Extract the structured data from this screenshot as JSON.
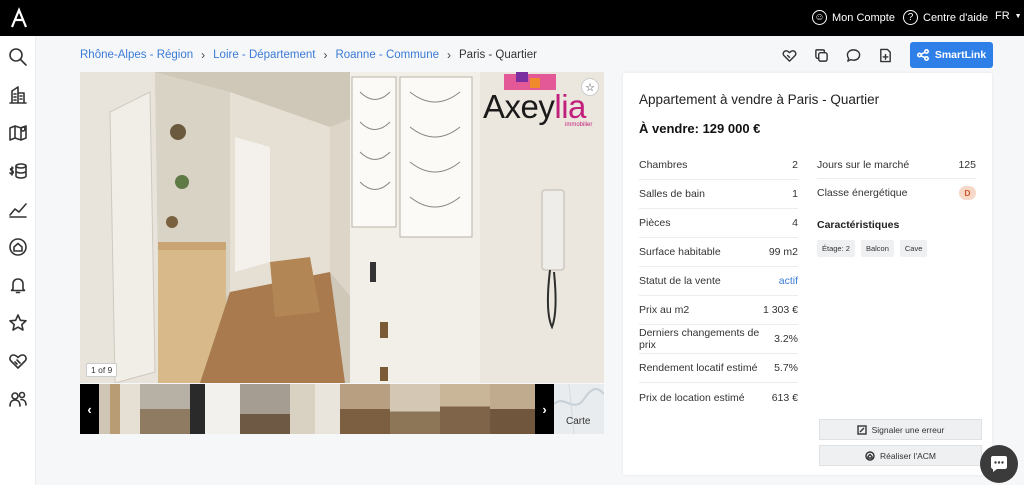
{
  "topbar": {
    "account_label": "Mon Compte",
    "help_label": "Centre d'aide",
    "lang": "FR"
  },
  "sidebar": {
    "items": [
      "search-icon",
      "building-icon",
      "map-icon",
      "finance-icon",
      "chart-icon",
      "home-alert-icon",
      "bell-icon",
      "star-icon",
      "handshake-icon",
      "users-icon"
    ]
  },
  "breadcrumb": [
    {
      "label": "Rhône-Alpes - Région"
    },
    {
      "label": "Loire - Département"
    },
    {
      "label": "Roanne - Commune"
    },
    {
      "label": "Paris - Quartier"
    }
  ],
  "toolbar": {
    "smartlink_label": "SmartLink"
  },
  "gallery": {
    "counter": "1 of 9",
    "brand_main": "Axey",
    "brand_accent": "lia",
    "brand_sub": "immobilier",
    "map_label": "Carte"
  },
  "listing": {
    "title": "Appartement à vendre à Paris - Quartier",
    "price": "À vendre: 129 000 €",
    "left_rows": [
      {
        "label": "Chambres",
        "value": "2"
      },
      {
        "label": "Salles de bain",
        "value": "1"
      },
      {
        "label": "Pièces",
        "value": "4"
      },
      {
        "label": "Surface habitable",
        "value": "99 m2"
      },
      {
        "label": "Statut de la vente",
        "value": "actif"
      },
      {
        "label": "Prix au m2",
        "value": "1 303 €"
      },
      {
        "label": "Derniers changements de prix",
        "value": "3.2%"
      },
      {
        "label": "Rendement locatif estimé",
        "value": "5.7%"
      },
      {
        "label": "Prix de location estimé",
        "value": "613 €"
      }
    ],
    "right_rows": [
      {
        "label": "Jours sur le marché",
        "value": "125"
      },
      {
        "label": "Classe énergétique",
        "value": "D"
      }
    ],
    "features_title": "Caractéristiques",
    "features": [
      "Étage: 2",
      "Balcon",
      "Cave"
    ],
    "report_label": "Signaler une erreur",
    "acm_label": "Réaliser l'ACM"
  },
  "colors": {
    "accent": "#2f7fe8",
    "link": "#3a7bd5",
    "brand": "#c21e7b",
    "energy_badge": "#f6d8c8"
  }
}
